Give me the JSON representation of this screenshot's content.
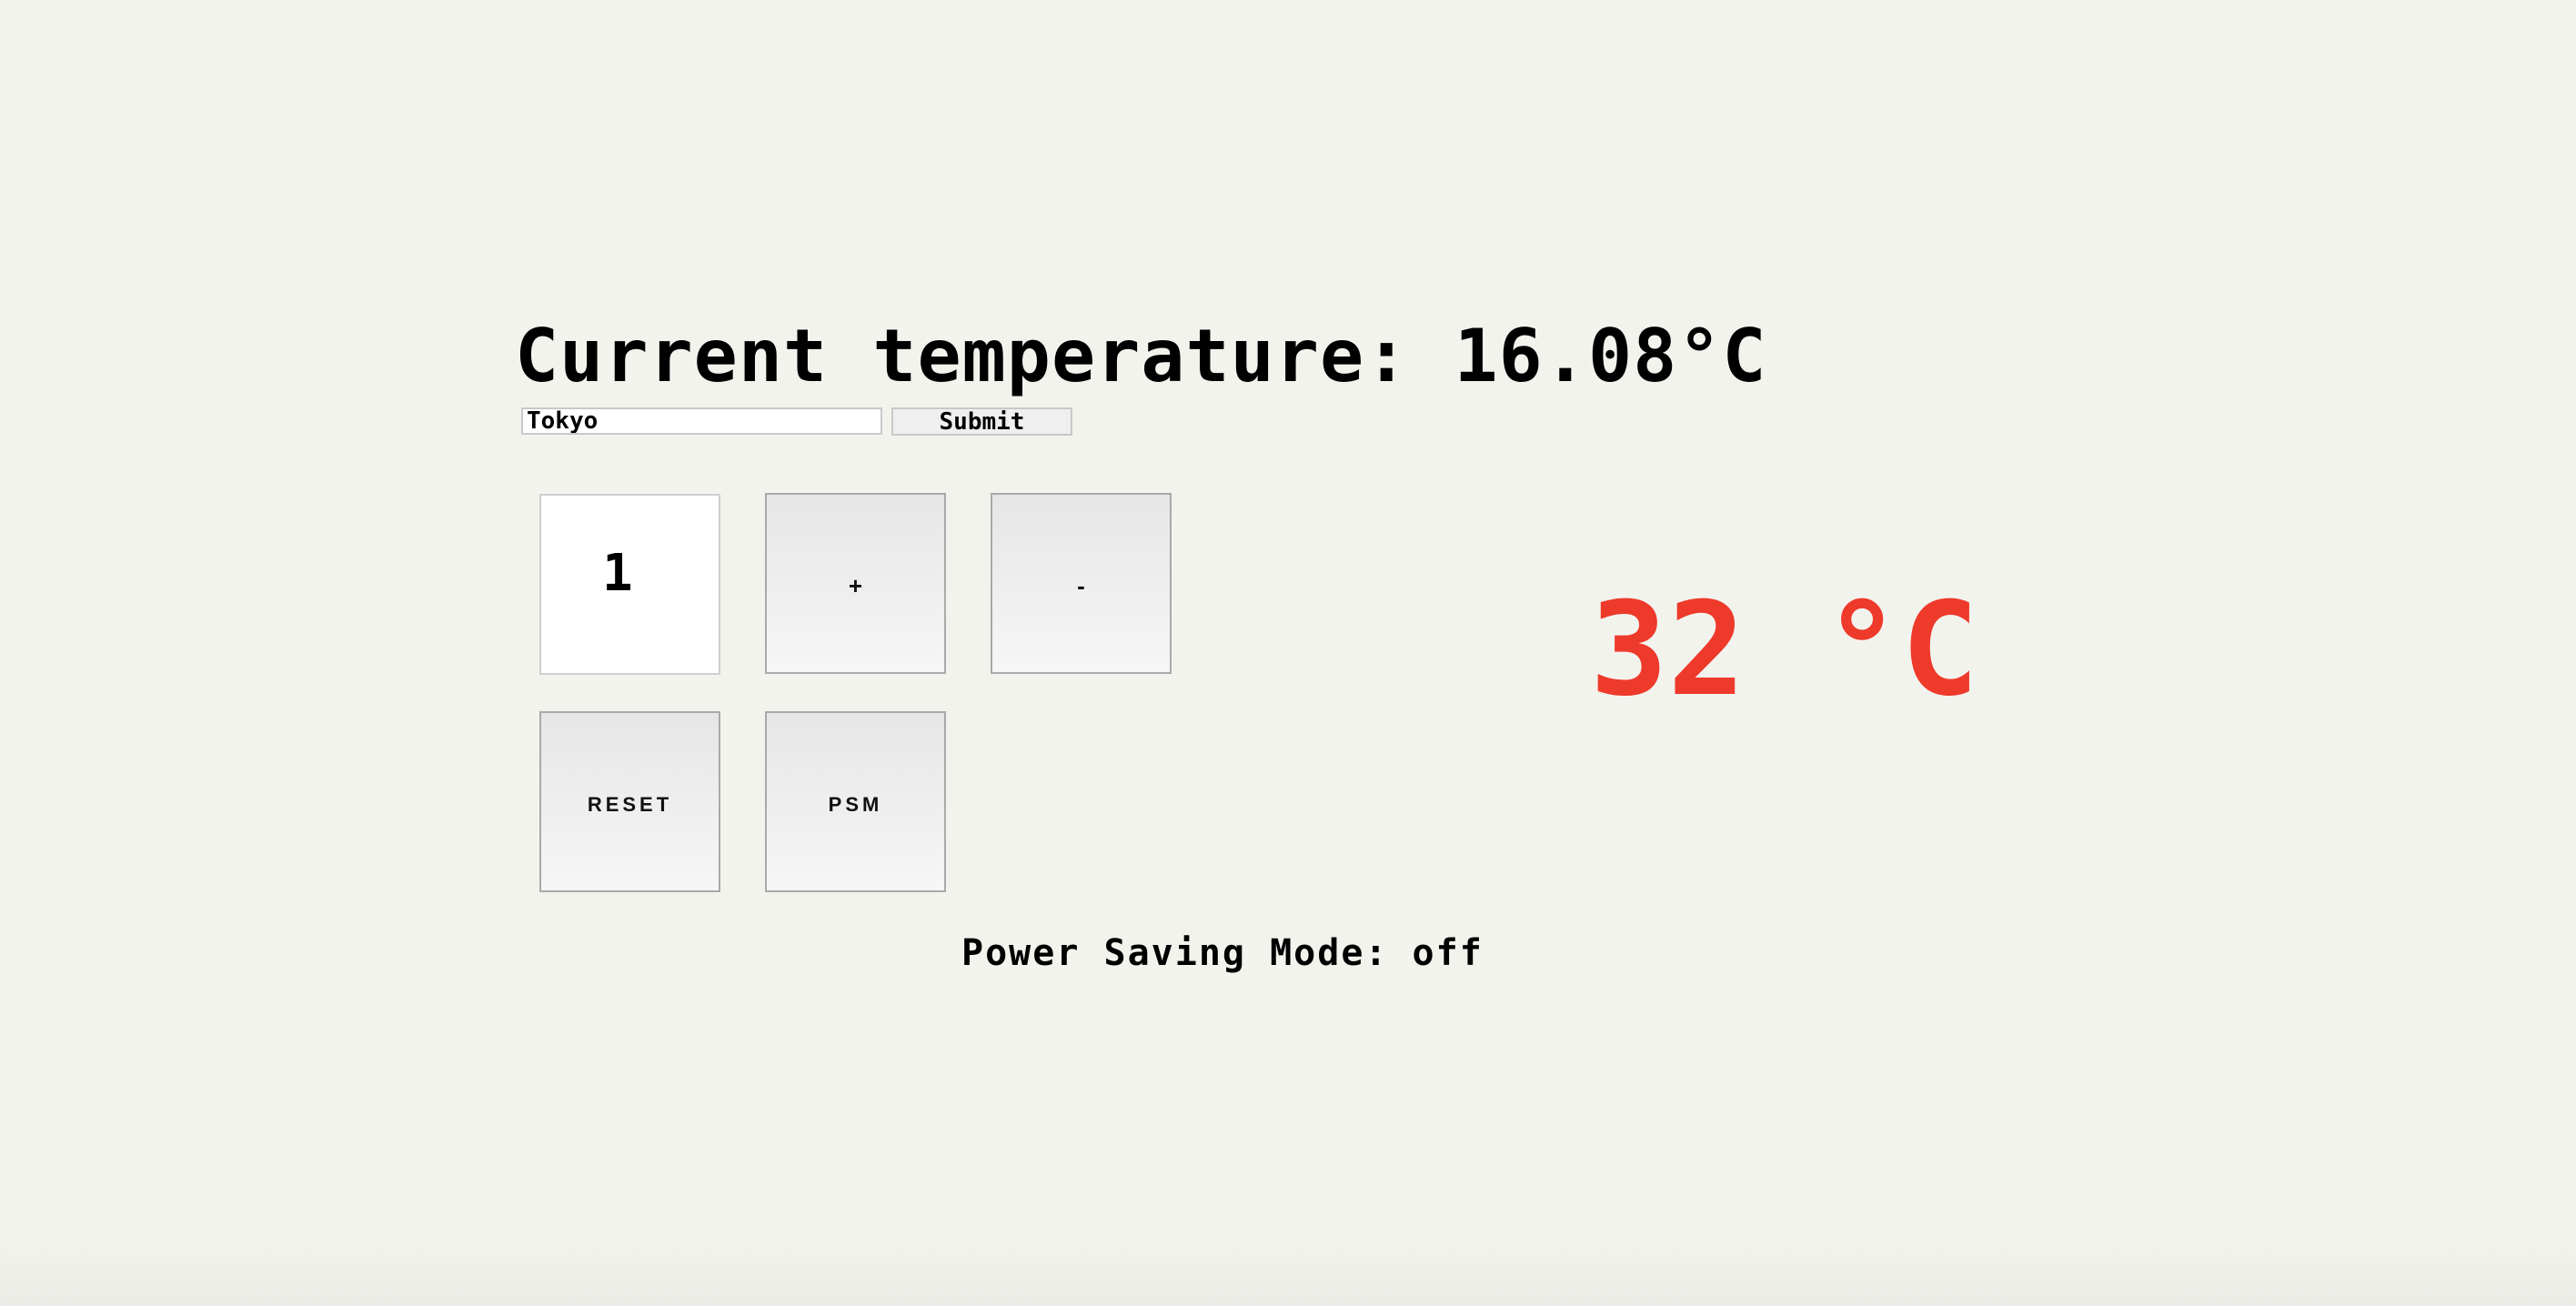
{
  "header": {
    "title": "Current temperature: 16.08°C"
  },
  "city_form": {
    "input_value": "Tokyo",
    "submit_label": "Submit"
  },
  "controls": {
    "counter_value": "1",
    "increment_label": "+",
    "decrement_label": "-",
    "reset_label": "RESET",
    "psm_label": "PSM"
  },
  "display": {
    "set_temperature": "32 °C"
  },
  "status": {
    "power_saving_mode": "Power Saving Mode: off"
  },
  "colors": {
    "background": "#f3f3ee",
    "set_temperature_color": "#ee3a2b",
    "text": "#000000"
  }
}
